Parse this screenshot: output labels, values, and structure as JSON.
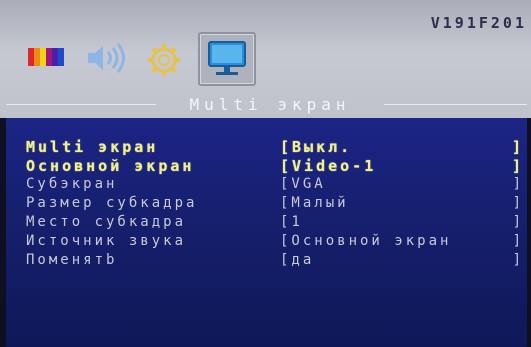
{
  "header": {
    "model": "V191F201"
  },
  "toolbar": {
    "icons": [
      "color-bars-icon",
      "speaker-icon",
      "gear-icon",
      "monitor-icon"
    ],
    "selected": "monitor-icon"
  },
  "section": {
    "title": "Multi экран"
  },
  "menu": {
    "rows": [
      {
        "label": "Multi экран",
        "value": "[Выкл.",
        "close": "]"
      },
      {
        "label": "Основной экран",
        "value": "[Video-1",
        "close": "]"
      },
      {
        "label": "Субэкран",
        "value": "[VGA",
        "close": "]"
      },
      {
        "label": "Размер субкадра",
        "value": "[Малый",
        "close": "]"
      },
      {
        "label": "Место субкадра",
        "value": "[1",
        "close": "]"
      },
      {
        "label": "Источник звука",
        "value": "[Основной экран",
        "close": "]"
      },
      {
        "label": "Поменятb",
        "value": "[да",
        "close": "]"
      }
    ]
  },
  "colors": {
    "active_text": "#f1f08a",
    "inactive_text": "#c7cad8",
    "panel": "#1c2486"
  }
}
